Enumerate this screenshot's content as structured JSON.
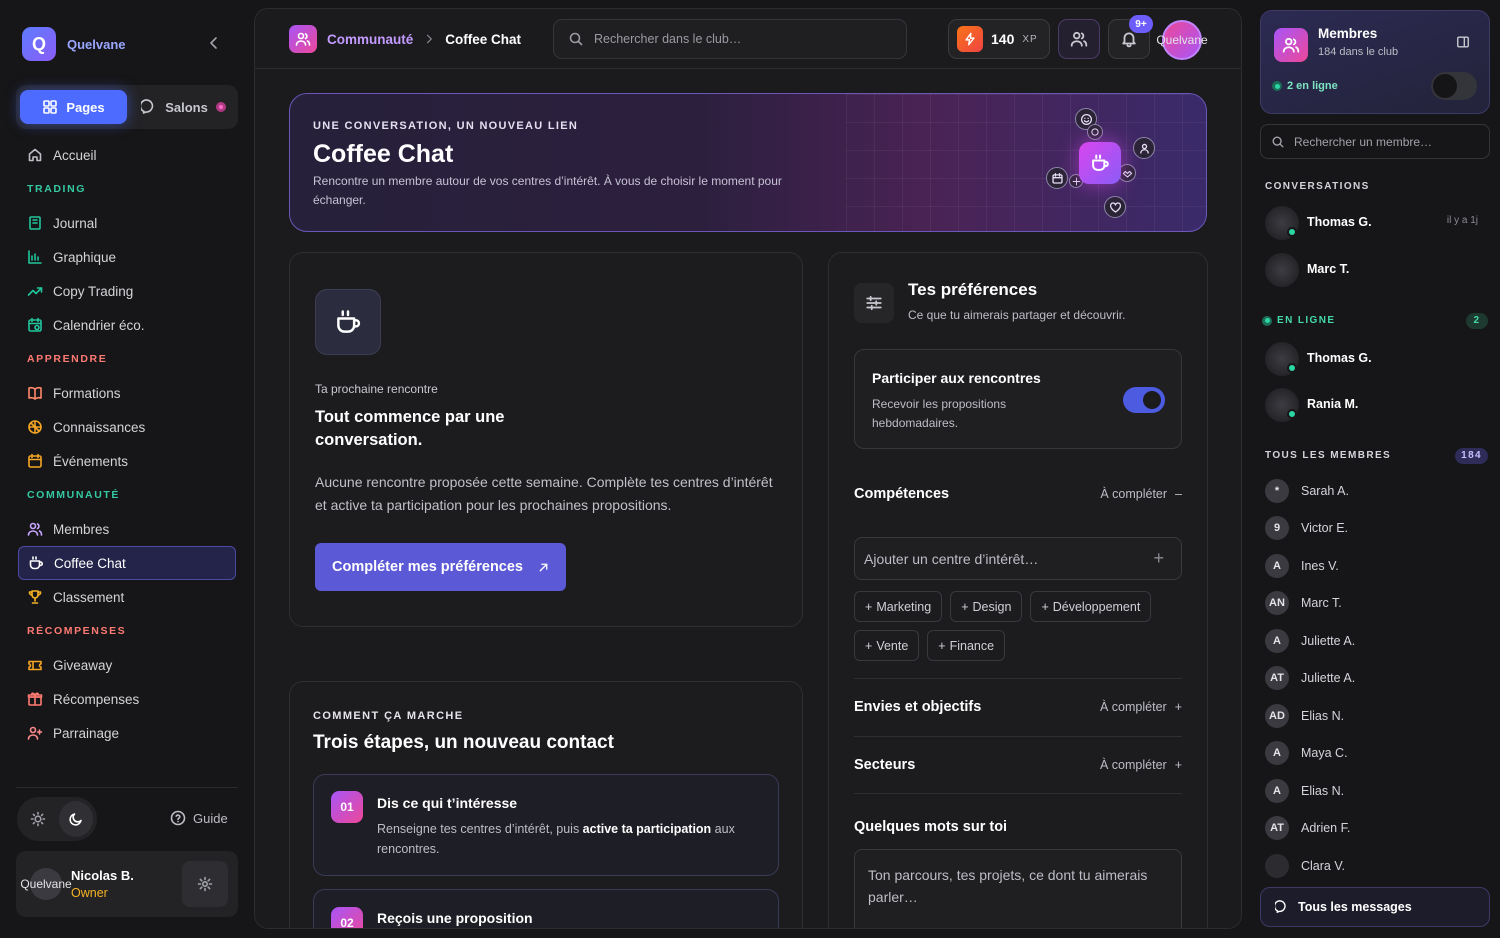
{
  "brand": {
    "name": "Quelvane",
    "logo_letter": "Q"
  },
  "sidebar": {
    "tabs": {
      "pages": "Pages",
      "salons": "Salons"
    },
    "home": "Accueil",
    "sections": [
      {
        "title": "TRADING",
        "color": "#35c9a3",
        "items": [
          "Journal",
          "Graphique",
          "Copy Trading",
          "Calendrier éco."
        ]
      },
      {
        "title": "APPRENDRE",
        "color": "#ff7a73",
        "items": [
          "Formations",
          "Connaissances",
          "Événements"
        ]
      },
      {
        "title": "COMMUNAUTÉ",
        "color": "#35c9a3",
        "items": [
          "Membres",
          "Coffee Chat",
          "Classement"
        ]
      },
      {
        "title": "RÉCOMPENSES",
        "color": "#ff7a73",
        "items": [
          "Giveaway",
          "Récompenses",
          "Parrainage"
        ]
      }
    ],
    "active_item": "Coffee Chat",
    "guide": "Guide",
    "profile": {
      "avatar_alt": "Quelvane",
      "name": "Nicolas B.",
      "role": "Owner"
    }
  },
  "topbar": {
    "breadcrumb": [
      "Communauté",
      "Coffee Chat"
    ],
    "search_placeholder": "Rechercher dans le club…",
    "xp_value": "140",
    "xp_unit": "XP",
    "notif_badge": "9+",
    "avatar_alt": "Quelvane"
  },
  "hero": {
    "kicker": "UNE CONVERSATION, UN NOUVEAU LIEN",
    "title": "Coffee Chat",
    "description": "Rencontre un membre autour de vos centres d’intérêt. À vous de choisir le moment pour échanger."
  },
  "next_meeting": {
    "kicker": "Ta prochaine rencontre",
    "title": "Tout commence par une conversation.",
    "description": "Aucune rencontre proposée cette semaine. Complète tes centres d’intérêt et active ta participation pour les prochaines propositions.",
    "button": "Compléter mes préférences"
  },
  "how_it_works": {
    "kicker": "COMMENT ÇA MARCHE",
    "title": "Trois étapes, un nouveau contact",
    "steps": [
      {
        "num": "01",
        "title": "Dis ce qui t’intéresse",
        "desc_a": "Renseigne tes centres d’intérêt, puis ",
        "desc_b": "active ta participation",
        "desc_c": " aux rencontres."
      },
      {
        "num": "02",
        "title": "Reçois une proposition"
      }
    ]
  },
  "preferences": {
    "title": "Tes préférences",
    "subtitle": "Ce que tu aimerais partager et découvrir.",
    "participate_title": "Participer aux rencontres",
    "participate_desc": "Recevoir les propositions hebdomadaires.",
    "participate_on": true,
    "skills_label": "Compétences",
    "to_complete": "À compléter",
    "add_placeholder": "Ajouter un centre d’intérêt…",
    "chips": [
      "Marketing",
      "Design",
      "Développement",
      "Vente",
      "Finance"
    ],
    "goals_label": "Envies et objectifs",
    "sectors_label": "Secteurs",
    "bio_label": "Quelques mots sur toi",
    "bio_placeholder": "Ton parcours, tes projets, ce dont tu aimerais parler…"
  },
  "right": {
    "members_title": "Membres",
    "members_sub": "184 dans le club",
    "online_label": "2 en ligne",
    "search_placeholder": "Rechercher un membre…",
    "conversations_label": "CONVERSATIONS",
    "conversations": [
      {
        "name": "Thomas G.",
        "time": "il y a 1j",
        "online": true
      },
      {
        "name": "Marc T.",
        "time": "",
        "online": false
      }
    ],
    "online_section": "EN LIGNE",
    "online_count": "2",
    "online_members": [
      {
        "name": "Thomas G."
      },
      {
        "name": "Rania M."
      }
    ],
    "all_section": "TOUS LES MEMBRES",
    "all_count": "184",
    "members": [
      {
        "initials": "*",
        "name": "Sarah A."
      },
      {
        "initials": "9",
        "name": "Victor E."
      },
      {
        "initials": "A",
        "name": "Ines V."
      },
      {
        "initials": "AN",
        "name": "Marc T."
      },
      {
        "initials": "A",
        "name": "Juliette A."
      },
      {
        "initials": "AT",
        "name": "Juliette A."
      },
      {
        "initials": "AD",
        "name": "Elias N."
      },
      {
        "initials": "A",
        "name": "Maya C."
      },
      {
        "initials": "A",
        "name": "Elias N."
      },
      {
        "initials": "AT",
        "name": "Adrien F."
      },
      {
        "initials": "",
        "name": "Clara V."
      }
    ],
    "all_messages": "Tous les messages"
  }
}
